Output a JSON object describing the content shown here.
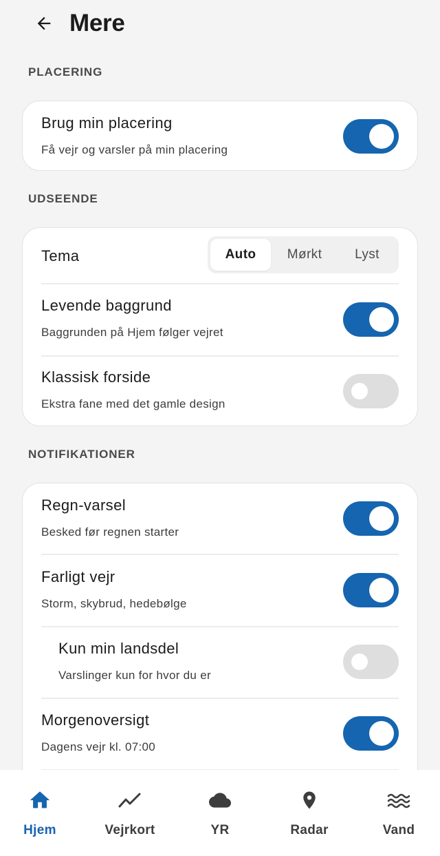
{
  "header": {
    "title": "Mere",
    "back_icon": "arrow-left-icon"
  },
  "sections": {
    "placement": {
      "label": "PLACERING",
      "use_location": {
        "title": "Brug min placering",
        "subtitle": "Få vejr og varsler på min placering",
        "enabled": true
      }
    },
    "appearance": {
      "label": "UDSEENDE",
      "theme": {
        "title": "Tema",
        "options": [
          "Auto",
          "Mørkt",
          "Lyst"
        ],
        "selected": "Auto"
      },
      "live_background": {
        "title": "Levende baggrund",
        "subtitle": "Baggrunden på Hjem følger vejret",
        "enabled": true
      },
      "classic_frontpage": {
        "title": "Klassisk forside",
        "subtitle": "Ekstra fane med det gamle design",
        "enabled": false
      }
    },
    "notifications": {
      "label": "NOTIFIKATIONER",
      "rain_alert": {
        "title": "Regn-varsel",
        "subtitle": "Besked før regnen starter",
        "enabled": true
      },
      "dangerous_weather": {
        "title": "Farligt vejr",
        "subtitle": "Storm, skybrud, hedebølge",
        "enabled": true
      },
      "only_my_region": {
        "title": "Kun min landsdel",
        "subtitle": "Varslinger kun for hvor du er",
        "enabled": false
      },
      "morning_overview": {
        "title": "Morgenoversigt",
        "subtitle": "Dagens vejr kl. 07:00",
        "enabled": true
      }
    }
  },
  "bottom_nav": {
    "items": [
      {
        "label": "Hjem",
        "icon": "home-icon",
        "active": true
      },
      {
        "label": "Vejrkort",
        "icon": "trend-line-icon",
        "active": false
      },
      {
        "label": "YR",
        "icon": "cloud-icon",
        "active": false
      },
      {
        "label": "Radar",
        "icon": "location-pin-icon",
        "active": false
      },
      {
        "label": "Vand",
        "icon": "waves-icon",
        "active": false
      }
    ]
  },
  "colors": {
    "accent": "#1565b0",
    "background": "#f4f4f4",
    "card": "#ffffff",
    "toggle_off": "#dedede"
  }
}
